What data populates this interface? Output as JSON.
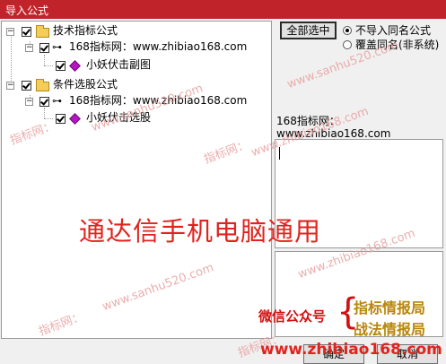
{
  "window": {
    "title": "导入公式"
  },
  "tree": {
    "groups": [
      {
        "label": "技术指标公式",
        "source": "168指标网：www.zhibiao168.com",
        "item": "小妖伏击副图"
      },
      {
        "label": "条件选股公式",
        "source": "168指标网：www.zhibiao168.com",
        "item": "小妖伏击选股"
      }
    ]
  },
  "controls": {
    "select_all": "全部选中",
    "radio_skip": "不导入同名公式",
    "radio_overwrite": "覆盖同名(非系统)",
    "selected_radio": "skip"
  },
  "info": {
    "line1": "168指标网：",
    "line2": "www.zhibiao168.com"
  },
  "buttons": {
    "ok": "确定",
    "cancel": "取消"
  },
  "watermarks": {
    "tl": "指标网：",
    "mid1": "www.sanhu520.com",
    "right1": "指标网：",
    "right2": "www.zhibiao168.com",
    "left2": "指标网：",
    "mid2": "www.sanhu520.com",
    "right3": "www.zhibiao168.com",
    "left3": "指标网：",
    "mid3": "www.sanhu520.com"
  },
  "overlay": {
    "headline": "通达信手机电脑通用",
    "wechat": "微信公众号",
    "gold1": "指标情报局",
    "gold2": "战法情报局",
    "site": "www.zhibiao168.com"
  },
  "colors": {
    "titlebar": "#c0242a",
    "overlay_red": "#e0231e",
    "gold": "#b8860b"
  }
}
